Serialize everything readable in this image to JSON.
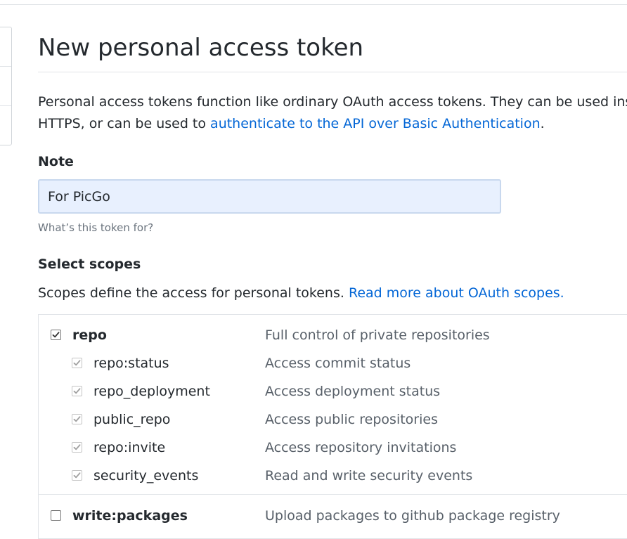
{
  "page": {
    "title": "New personal access token",
    "intro_text": "Personal access tokens function like ordinary OAuth access tokens. They can be used instea",
    "intro_line2_prefix": "HTTPS, or can be used to ",
    "intro_link": "authenticate to the API over Basic Authentication",
    "intro_line2_suffix": "."
  },
  "note": {
    "label": "Note",
    "value": "For PicGo",
    "hint": "What’s this token for?"
  },
  "scopes": {
    "heading": "Select scopes",
    "description": "Scopes define the access for personal tokens. ",
    "description_link": "Read more about OAuth scopes.",
    "items": [
      {
        "name": "repo",
        "desc": "Full control of private repositories",
        "checked": true,
        "child": false
      },
      {
        "name": "repo:status",
        "desc": "Access commit status",
        "checked": true,
        "child": true
      },
      {
        "name": "repo_deployment",
        "desc": "Access deployment status",
        "checked": true,
        "child": true
      },
      {
        "name": "public_repo",
        "desc": "Access public repositories",
        "checked": true,
        "child": true
      },
      {
        "name": "repo:invite",
        "desc": "Access repository invitations",
        "checked": true,
        "child": true
      },
      {
        "name": "security_events",
        "desc": "Read and write security events",
        "checked": true,
        "child": true
      },
      {
        "name": "write:packages",
        "desc": "Upload packages to github package registry",
        "checked": false,
        "child": false
      }
    ]
  },
  "colors": {
    "link": "#0366d6",
    "muted": "#586069",
    "input_bg": "#e8f0fe"
  }
}
